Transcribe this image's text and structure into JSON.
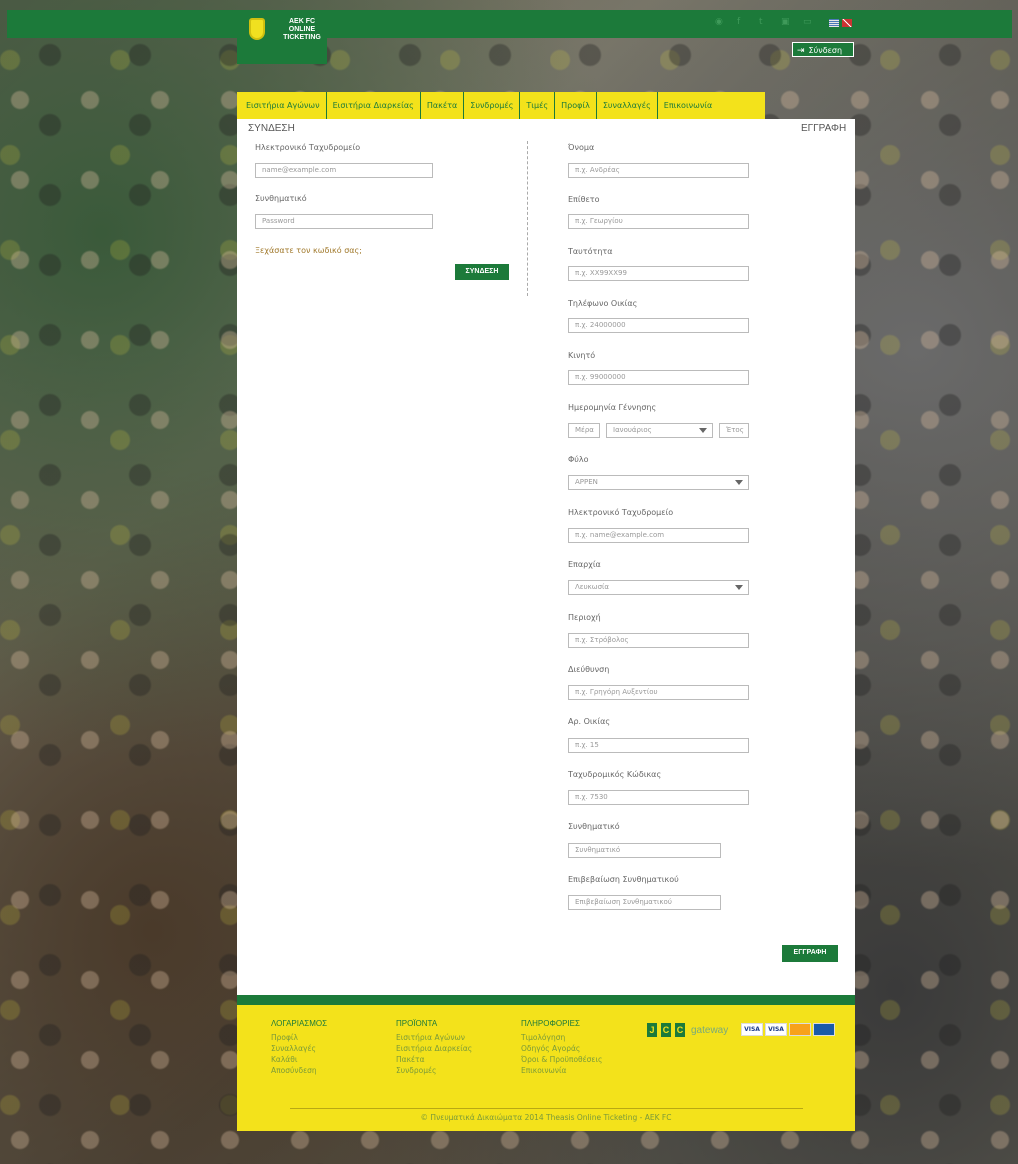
{
  "logo": {
    "line1": "AEK FC",
    "line2": "ONLINE",
    "line3": "TICKETING"
  },
  "header": {
    "signin_label": "Σύνδεση"
  },
  "nav": [
    "Εισιτήρια Αγώνων",
    "Εισιτήρια Διαρκείας",
    "Πακέτα",
    "Συνδρομές",
    "Τιμές",
    "Προφίλ",
    "Συναλλαγές",
    "Επικοινωνία"
  ],
  "login": {
    "title": "ΣΥΝΔΕΣΗ",
    "email_label": "Ηλεκτρονικό Ταχυδρομείο",
    "email_placeholder": "name@example.com",
    "password_label": "Συνθηματικό",
    "password_placeholder": "Password",
    "forgot": "Ξεχάσατε τον κωδικό σας;",
    "submit": "ΣΥΝΔΕΣΗ"
  },
  "register": {
    "title": "ΕΓΓΡΑΦΗ",
    "submit": "ΕΓΓΡΑΦΗ",
    "fields": {
      "name": {
        "label": "Όνομα",
        "placeholder": "π.χ. Ανδρέας"
      },
      "surname": {
        "label": "Επίθετο",
        "placeholder": "π.χ. Γεωργίου"
      },
      "id": {
        "label": "Ταυτότητα",
        "placeholder": "π.χ. XX99XX99"
      },
      "phone": {
        "label": "Τηλέφωνο Οικίας",
        "placeholder": "π.χ. 24000000"
      },
      "mobile": {
        "label": "Κινητό",
        "placeholder": "π.χ. 99000000"
      },
      "dob": {
        "label": "Ημερομηνία Γέννησης",
        "day_placeholder": "Μέρα",
        "month_value": "Ιανουάριος",
        "year_placeholder": "Έτος"
      },
      "gender": {
        "label": "Φύλο",
        "value": "ΑΡΡΕΝ"
      },
      "email": {
        "label": "Ηλεκτρονικό Ταχυδρομείο",
        "placeholder": "π.χ. name@example.com"
      },
      "province": {
        "label": "Επαρχία",
        "value": "Λευκωσία"
      },
      "area": {
        "label": "Περιοχή",
        "placeholder": "π.χ. Στρόβολος"
      },
      "address": {
        "label": "Διεύθυνση",
        "placeholder": "π.χ. Γρηγόρη Αυξεντίου"
      },
      "number": {
        "label": "Αρ. Οικίας",
        "placeholder": "π.χ. 15"
      },
      "postcode": {
        "label": "Ταχυδρομικός Κώδικας",
        "placeholder": "π.χ. 7530"
      },
      "password": {
        "label": "Συνθηματικό",
        "placeholder": "Συνθηματικό"
      },
      "password_confirm": {
        "label": "Επιβεβαίωση Συνθηματικού",
        "placeholder": "Επιβεβαίωση Συνθηματικού"
      }
    }
  },
  "footer": {
    "col1": {
      "title": "ΛΟΓΑΡΙΑΣΜΟΣ",
      "links": [
        "Προφίλ",
        "Συναλλαγές",
        "Καλάθι",
        "Αποσύνδεση"
      ]
    },
    "col2": {
      "title": "ΠΡΟΪΟΝΤΑ",
      "links": [
        "Εισιτήρια Αγώνων",
        "Εισιτήρια Διαρκείας",
        "Πακέτα",
        "Συνδρομές"
      ]
    },
    "col3": {
      "title": "ΠΛΗΡΟΦΟΡΙΕΣ",
      "links": [
        "Τιμολόγηση",
        "Οδηγός Αγοράς",
        "Όροι & Προϋποθέσεις",
        "Επικοινωνία"
      ]
    },
    "jcc_letters": [
      "J",
      "C",
      "C"
    ],
    "jcc_gateway": "gateway",
    "cards": [
      "VISA",
      "VISA"
    ],
    "copyright": "© Πνευματικά Δικαιώματα 2014 Theasis Online Ticketing - AEK FC"
  },
  "colors": {
    "brand_green": "#1c7a3a",
    "brand_yellow": "#f3e21b"
  }
}
